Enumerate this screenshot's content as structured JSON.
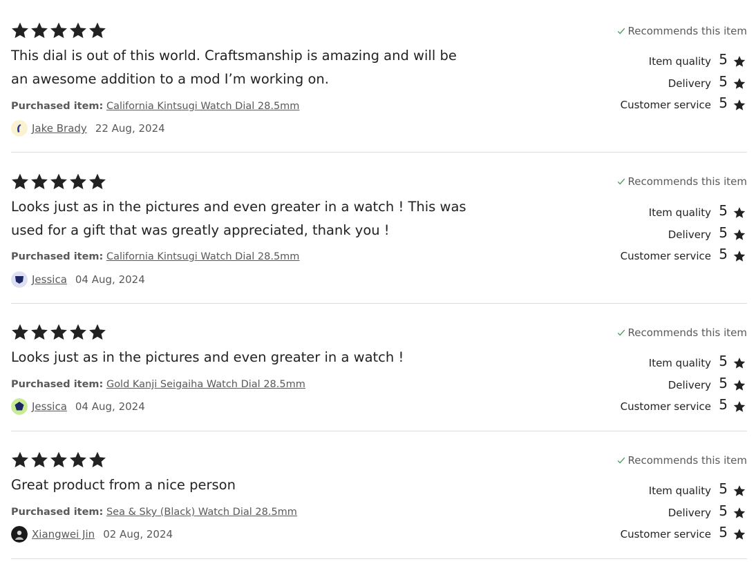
{
  "colors": {
    "star": "#222222",
    "check": "#4b9e5f",
    "divider": "#dcdcdc",
    "muted_text": "#595959"
  },
  "labels": {
    "recommends": "Recommends this item",
    "purchased_item": "Purchased item:",
    "item_quality": "Item quality",
    "delivery": "Delivery",
    "customer_service": "Customer service"
  },
  "reviews": [
    {
      "stars": 5,
      "text": "This dial is out of this world. Craftsmanship is amazing and will be an awesome addition to a mod I’m working on.",
      "item": "California Kintsugi Watch Dial 28.5mm",
      "reviewer": "Jake Brady",
      "date": "22 Aug, 2024",
      "avatar_icon": "crescent-avatar-icon",
      "item_quality": "5",
      "delivery": "5",
      "customer_service": "5"
    },
    {
      "stars": 5,
      "text": "Looks just as in the pictures and even greater in a watch ! This was used for a gift that was greatly appreciated, thank you !",
      "item": "California Kintsugi Watch Dial 28.5mm",
      "reviewer": "Jessica",
      "date": "04 Aug, 2024",
      "avatar_icon": "shield-avatar-icon",
      "item_quality": "5",
      "delivery": "5",
      "customer_service": "5"
    },
    {
      "stars": 5,
      "text": "Looks just as in the pictures and even greater in a watch !",
      "item": "Gold Kanji Seigaiha Watch Dial 28.5mm",
      "reviewer": "Jessica",
      "date": "04 Aug, 2024",
      "avatar_icon": "pentagon-avatar-icon",
      "item_quality": "5",
      "delivery": "5",
      "customer_service": "5"
    },
    {
      "stars": 5,
      "text": "Great product from a nice person",
      "item": "Sea & Sky (Black) Watch Dial 28.5mm",
      "reviewer": "Xiangwei Jin",
      "date": "02 Aug, 2024",
      "avatar_icon": "photo-avatar-icon",
      "item_quality": "5",
      "delivery": "5",
      "customer_service": "5"
    }
  ]
}
